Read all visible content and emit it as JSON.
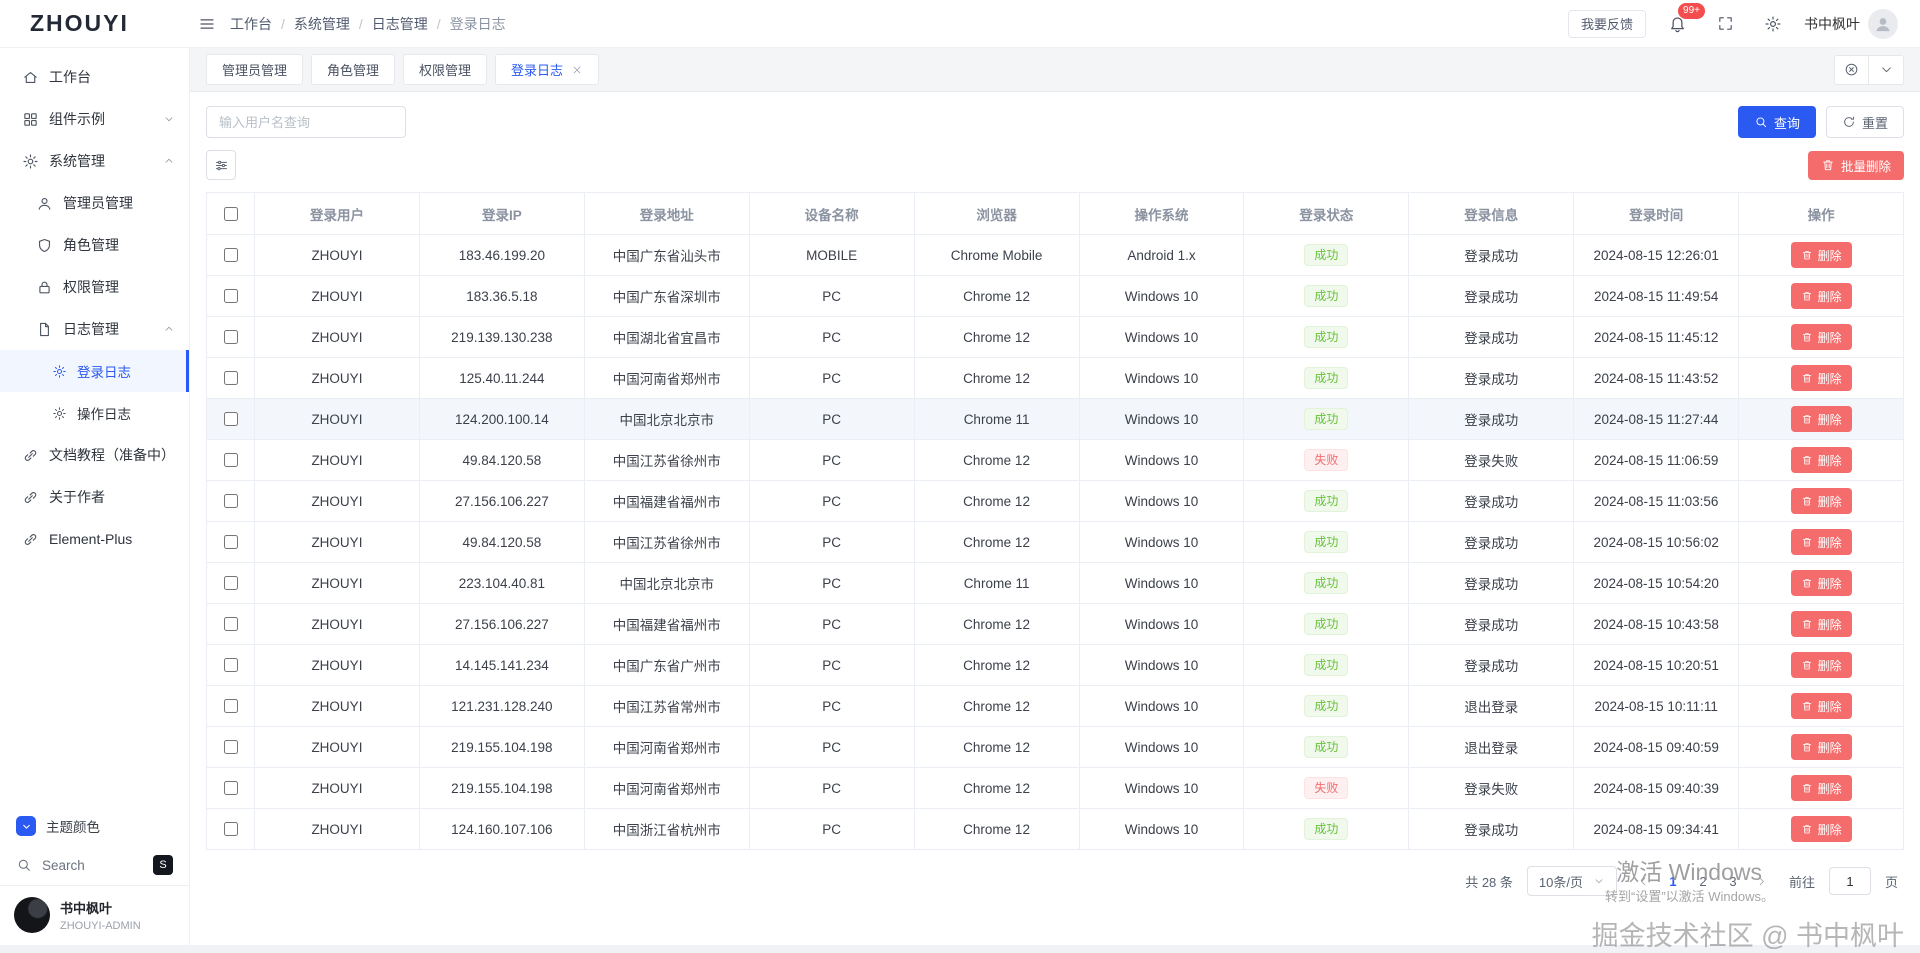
{
  "header": {
    "logo": "ZHOUYI",
    "breadcrumb": [
      "工作台",
      "系统管理",
      "日志管理",
      "登录日志"
    ],
    "feedback_label": "我要反馈",
    "notification_badge": "99+",
    "username": "书中枫叶"
  },
  "sidebar": {
    "items": [
      {
        "label": "工作台"
      },
      {
        "label": "组件示例"
      },
      {
        "label": "系统管理"
      },
      {
        "label": "管理员管理"
      },
      {
        "label": "角色管理"
      },
      {
        "label": "权限管理"
      },
      {
        "label": "日志管理"
      },
      {
        "label": "登录日志"
      },
      {
        "label": "操作日志"
      },
      {
        "label": "文档教程（准备中）"
      },
      {
        "label": "关于作者"
      },
      {
        "label": "Element-Plus"
      }
    ],
    "theme_label": "主题颜色",
    "search_label": "Search",
    "search_shortcut": "S",
    "user_name": "书中枫叶",
    "user_role": "ZHOUYI-ADMIN"
  },
  "tabs": [
    {
      "label": "管理员管理",
      "active": false
    },
    {
      "label": "角色管理",
      "active": false
    },
    {
      "label": "权限管理",
      "active": false
    },
    {
      "label": "登录日志",
      "active": true
    }
  ],
  "filters": {
    "username_placeholder": "输入用户名查询",
    "query_label": "查询",
    "reset_label": "重置",
    "batch_delete_label": "批量删除"
  },
  "table": {
    "columns": [
      "登录用户",
      "登录IP",
      "登录地址",
      "设备名称",
      "浏览器",
      "操作系统",
      "登录状态",
      "登录信息",
      "登录时间",
      "操作"
    ],
    "delete_label": "删除",
    "highlighted_row_index": 4,
    "rows": [
      {
        "user": "ZHOUYI",
        "ip": "183.46.199.20",
        "address": "中国广东省汕头市",
        "device": "MOBILE",
        "browser": "Chrome Mobile",
        "os": "Android 1.x",
        "status": "成功",
        "status_type": "success",
        "info": "登录成功",
        "time": "2024-08-15 12:26:01"
      },
      {
        "user": "ZHOUYI",
        "ip": "183.36.5.18",
        "address": "中国广东省深圳市",
        "device": "PC",
        "browser": "Chrome 12",
        "os": "Windows 10",
        "status": "成功",
        "status_type": "success",
        "info": "登录成功",
        "time": "2024-08-15 11:49:54"
      },
      {
        "user": "ZHOUYI",
        "ip": "219.139.130.238",
        "address": "中国湖北省宜昌市",
        "device": "PC",
        "browser": "Chrome 12",
        "os": "Windows 10",
        "status": "成功",
        "status_type": "success",
        "info": "登录成功",
        "time": "2024-08-15 11:45:12"
      },
      {
        "user": "ZHOUYI",
        "ip": "125.40.11.244",
        "address": "中国河南省郑州市",
        "device": "PC",
        "browser": "Chrome 12",
        "os": "Windows 10",
        "status": "成功",
        "status_type": "success",
        "info": "登录成功",
        "time": "2024-08-15 11:43:52"
      },
      {
        "user": "ZHOUYI",
        "ip": "124.200.100.14",
        "address": "中国北京北京市",
        "device": "PC",
        "browser": "Chrome 11",
        "os": "Windows 10",
        "status": "成功",
        "status_type": "success",
        "info": "登录成功",
        "time": "2024-08-15 11:27:44"
      },
      {
        "user": "ZHOUYI",
        "ip": "49.84.120.58",
        "address": "中国江苏省徐州市",
        "device": "PC",
        "browser": "Chrome 12",
        "os": "Windows 10",
        "status": "失败",
        "status_type": "fail",
        "info": "登录失败",
        "time": "2024-08-15 11:06:59"
      },
      {
        "user": "ZHOUYI",
        "ip": "27.156.106.227",
        "address": "中国福建省福州市",
        "device": "PC",
        "browser": "Chrome 12",
        "os": "Windows 10",
        "status": "成功",
        "status_type": "success",
        "info": "登录成功",
        "time": "2024-08-15 11:03:56"
      },
      {
        "user": "ZHOUYI",
        "ip": "49.84.120.58",
        "address": "中国江苏省徐州市",
        "device": "PC",
        "browser": "Chrome 12",
        "os": "Windows 10",
        "status": "成功",
        "status_type": "success",
        "info": "登录成功",
        "time": "2024-08-15 10:56:02"
      },
      {
        "user": "ZHOUYI",
        "ip": "223.104.40.81",
        "address": "中国北京北京市",
        "device": "PC",
        "browser": "Chrome 11",
        "os": "Windows 10",
        "status": "成功",
        "status_type": "success",
        "info": "登录成功",
        "time": "2024-08-15 10:54:20"
      },
      {
        "user": "ZHOUYI",
        "ip": "27.156.106.227",
        "address": "中国福建省福州市",
        "device": "PC",
        "browser": "Chrome 12",
        "os": "Windows 10",
        "status": "成功",
        "status_type": "success",
        "info": "登录成功",
        "time": "2024-08-15 10:43:58"
      },
      {
        "user": "ZHOUYI",
        "ip": "14.145.141.234",
        "address": "中国广东省广州市",
        "device": "PC",
        "browser": "Chrome 12",
        "os": "Windows 10",
        "status": "成功",
        "status_type": "success",
        "info": "登录成功",
        "time": "2024-08-15 10:20:51"
      },
      {
        "user": "ZHOUYI",
        "ip": "121.231.128.240",
        "address": "中国江苏省常州市",
        "device": "PC",
        "browser": "Chrome 12",
        "os": "Windows 10",
        "status": "成功",
        "status_type": "success",
        "info": "退出登录",
        "time": "2024-08-15 10:11:11"
      },
      {
        "user": "ZHOUYI",
        "ip": "219.155.104.198",
        "address": "中国河南省郑州市",
        "device": "PC",
        "browser": "Chrome 12",
        "os": "Windows 10",
        "status": "成功",
        "status_type": "success",
        "info": "退出登录",
        "time": "2024-08-15 09:40:59"
      },
      {
        "user": "ZHOUYI",
        "ip": "219.155.104.198",
        "address": "中国河南省郑州市",
        "device": "PC",
        "browser": "Chrome 12",
        "os": "Windows 10",
        "status": "失败",
        "status_type": "fail",
        "info": "登录失败",
        "time": "2024-08-15 09:40:39"
      },
      {
        "user": "ZHOUYI",
        "ip": "124.160.107.106",
        "address": "中国浙江省杭州市",
        "device": "PC",
        "browser": "Chrome 12",
        "os": "Windows 10",
        "status": "成功",
        "status_type": "success",
        "info": "登录成功",
        "time": "2024-08-15 09:34:41"
      }
    ]
  },
  "pagination": {
    "total_label": "共 28 条",
    "page_size_label": "10条/页",
    "pages": [
      "1",
      "2",
      "3"
    ],
    "active_page": "1",
    "goto_label": "前往",
    "goto_value": "1",
    "page_unit": "页"
  },
  "watermark": {
    "line1": "激活 Windows",
    "line2": "转到“设置”以激活 Windows。",
    "line3": "掘金技术社区 @ 书中枫叶"
  },
  "colors": {
    "primary": "#2a5af1",
    "danger": "#f56c6c",
    "success": "#67c23a"
  }
}
